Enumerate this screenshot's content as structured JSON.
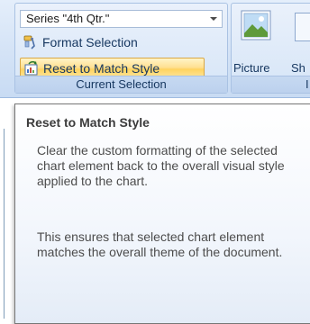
{
  "ribbon": {
    "current_selection": {
      "series_select": "Series \"4th Qtr.\"",
      "format_selection": "Format Selection",
      "reset_to_match_style": "Reset to Match Style",
      "group_label": "Current Selection"
    },
    "insert": {
      "picture_label": "Picture",
      "shapes_label_partial": "Sh",
      "group_label_partial": "I"
    }
  },
  "tooltip": {
    "title": "Reset to Match Style",
    "paragraph1": "Clear the custom formatting of the selected chart element back to the overall visual style applied to the chart.",
    "paragraph2": "This ensures that selected chart element matches the overall theme of the document."
  },
  "icons": {
    "format_selection": "format-brush-icon",
    "reset_to_match_style": "reset-style-icon",
    "picture": "picture-icon",
    "series_dropdown": "chevron-down-icon"
  },
  "colors": {
    "ribbon_bg": "#d4e3f6",
    "highlight": "#ffe092",
    "highlight_border": "#d9a744",
    "text": "#15365f"
  }
}
